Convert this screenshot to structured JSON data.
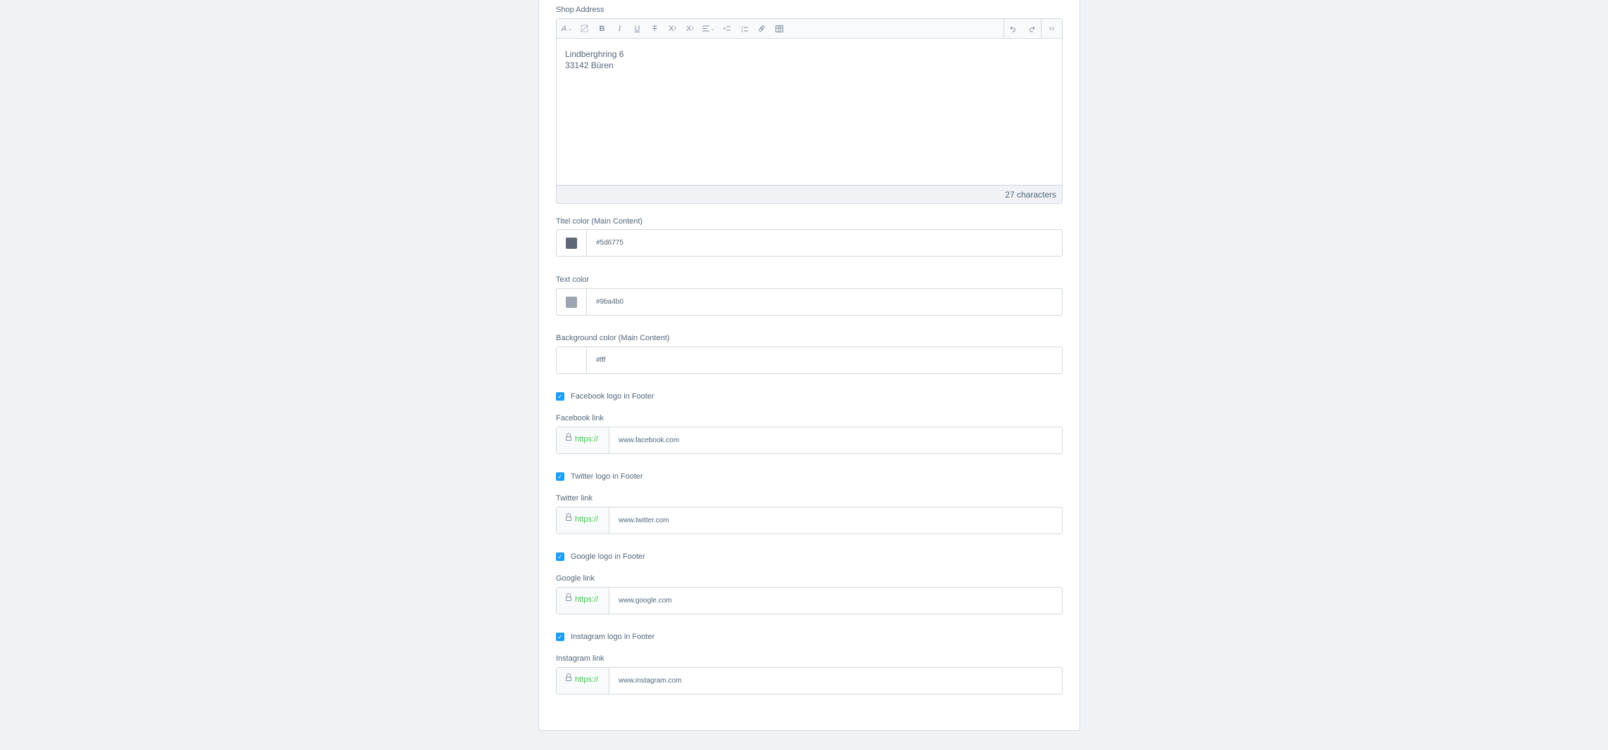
{
  "shop_address": {
    "label": "Shop Address",
    "lines": [
      "Lindberghring 6",
      "33142 Büren"
    ],
    "char_count": "27 characters",
    "toolbar_left_icons": [
      "text-format-icon",
      "clear-format-icon",
      "bold-icon",
      "italic-icon",
      "underline-icon",
      "strikethrough-icon",
      "superscript-icon",
      "subscript-icon",
      "align-icon",
      "numbered-list-icon",
      "bullet-list-icon",
      "link-icon",
      "table-icon"
    ],
    "toolbar_right_icons": [
      "undo-icon",
      "redo-icon",
      "code-view-icon"
    ],
    "toolbar_glyphs": {
      "text_format": "A",
      "bold": "B",
      "italic": "I",
      "underline": "U",
      "strike": "T",
      "superscript": "X",
      "subscript": "X",
      "code": "‹›"
    }
  },
  "colors": [
    {
      "label": "Titel color (Main Content)",
      "value": "#5d6775",
      "swatch": "#5d6775"
    },
    {
      "label": "Text color",
      "value": "#9ba4b0",
      "swatch": "#9ba4b0"
    },
    {
      "label": "Background color (Main Content)",
      "value": "#fff",
      "swatch": "#ffffff"
    }
  ],
  "social": [
    {
      "checkbox_label": "Facebook logo in Footer",
      "checked": true,
      "link_label": "Facebook link",
      "prefix": "https://",
      "value": "www.facebook.com"
    },
    {
      "checkbox_label": "Twitter logo in Footer",
      "checked": true,
      "link_label": "Twitter link",
      "prefix": "https://",
      "value": "www.twitter.com"
    },
    {
      "checkbox_label": "Google logo in Footer",
      "checked": true,
      "link_label": "Google link",
      "prefix": "https://",
      "value": "www.google.com"
    },
    {
      "checkbox_label": "Instagram logo in Footer",
      "checked": true,
      "link_label": "Instagram link",
      "prefix": "https://",
      "value": "www.instagram.com"
    }
  ],
  "theme": {
    "accent": "#189eff",
    "prefix_green": "#37d046",
    "border": "#d1d9e0",
    "text": "#52667a"
  }
}
